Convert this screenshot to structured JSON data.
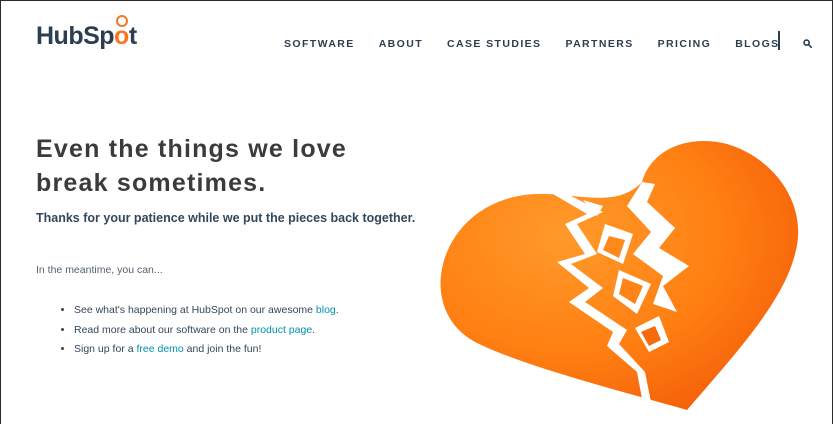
{
  "brand": {
    "logo_prefix": "HubSp",
    "logo_o": "o",
    "logo_suffix": "t",
    "accent_color": "#f57722",
    "text_color": "#2d3e50",
    "link_color": "#0091ae"
  },
  "nav": {
    "items": [
      {
        "label": "SOFTWARE"
      },
      {
        "label": "ABOUT"
      },
      {
        "label": "CASE STUDIES"
      },
      {
        "label": "PARTNERS"
      },
      {
        "label": "PRICING"
      },
      {
        "label": "BLOGS"
      }
    ],
    "search_icon": "search-icon"
  },
  "main": {
    "headline_line1": "Even the things we love",
    "headline_line2": "break sometimes.",
    "subhead": "Thanks for your patience while we put the pieces back together.",
    "meantime": "In the meantime, you can...",
    "list": [
      {
        "before": "See what's happening at HubSpot on our awesome ",
        "link": "blog",
        "after": "."
      },
      {
        "before": "Read more about our software on the ",
        "link": "product page",
        "after": "."
      },
      {
        "before": "Sign up for a ",
        "link": "free demo",
        "after": " and join the fun!"
      }
    ],
    "illustration": "broken-heart"
  }
}
